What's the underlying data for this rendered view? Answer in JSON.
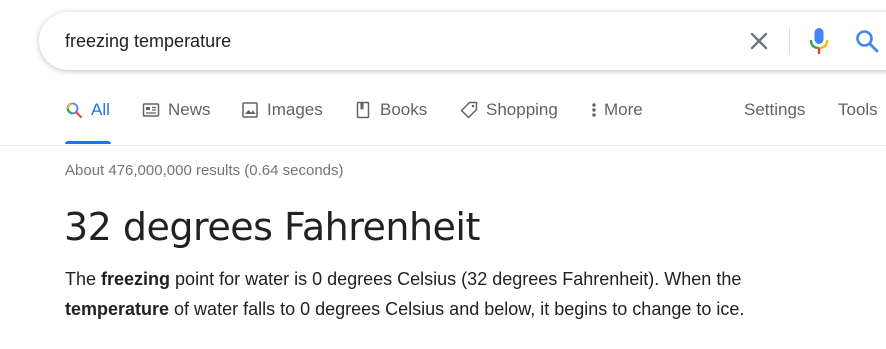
{
  "search": {
    "query": "freezing temperature"
  },
  "tabs": [
    {
      "label": "All",
      "icon": "search-icon",
      "active": true
    },
    {
      "label": "News",
      "icon": "news-icon"
    },
    {
      "label": "Images",
      "icon": "image-icon"
    },
    {
      "label": "Books",
      "icon": "book-icon"
    },
    {
      "label": "Shopping",
      "icon": "tag-icon"
    },
    {
      "label": "More",
      "icon": "more-vert-icon"
    },
    {
      "label": "Settings"
    },
    {
      "label": "Tools"
    }
  ],
  "results": {
    "stats": "About 476,000,000 results (0.64 seconds)"
  },
  "answer": {
    "title": "32 degrees Fahrenheit",
    "line1": {
      "p1": "The ",
      "b1": "freezing",
      "p2": " point for water is 0 degrees Celsius (32 degrees Fahrenheit). When the"
    },
    "line2": {
      "b1": "temperature",
      "p1": " of water falls to 0 degrees Celsius and below, it begins to change to ice."
    }
  },
  "colors": {
    "accent_blue": "#1a73e8",
    "mic_red": "#ea4335",
    "mic_yellow": "#fbbc04",
    "mic_green": "#34a853",
    "mic_blue": "#4285f4"
  }
}
